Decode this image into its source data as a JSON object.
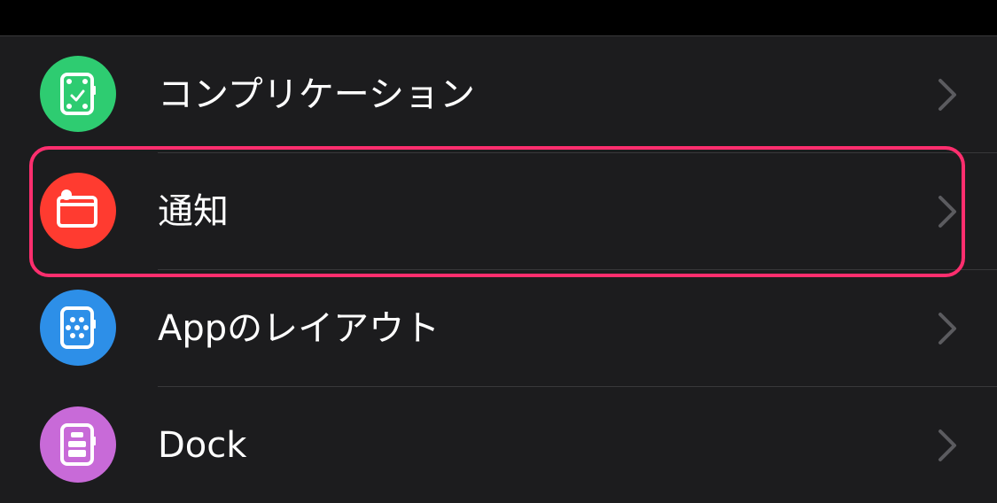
{
  "rows": [
    {
      "label": "コンプリケーション",
      "icon": "complications-icon",
      "color": "#2ecc71"
    },
    {
      "label": "通知",
      "icon": "notifications-icon",
      "color": "#ff3b30"
    },
    {
      "label": "Appのレイアウト",
      "icon": "app-layout-icon",
      "color": "#2d8fe8"
    },
    {
      "label": "Dock",
      "icon": "dock-icon",
      "color": "#c86ad8"
    }
  ],
  "colors": {
    "background": "#1c1c1e",
    "separator": "#38383a",
    "chevron": "#5b5b5f",
    "highlight": "#ff2e6e"
  }
}
